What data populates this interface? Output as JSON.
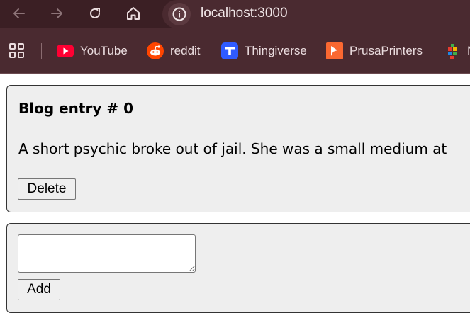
{
  "browser": {
    "url": "localhost:3000",
    "nav": {
      "back_icon": "arrow-left-icon",
      "forward_icon": "arrow-right-icon",
      "reload_icon": "reload-icon",
      "home_icon": "home-icon",
      "site_info_icon": "info-icon"
    },
    "bookmarks": [
      {
        "label": "YouTube",
        "icon": "youtube-icon",
        "color": "#ff0033"
      },
      {
        "label": "reddit",
        "icon": "reddit-icon",
        "color": "#ff4500"
      },
      {
        "label": "Thingiverse",
        "icon": "thingiverse-icon",
        "color": "#2f5bff"
      },
      {
        "label": "PrusaPrinters",
        "icon": "prusa-icon",
        "color": "#fa6831"
      },
      {
        "label": "N",
        "icon": "multicolor-icon",
        "color": "#e0a000"
      }
    ],
    "colors": {
      "toolbar": "#3b1f24",
      "bookmark_bar": "#4a2a30",
      "text": "#eadcde"
    }
  },
  "blog": {
    "entries": [
      {
        "title": "Blog entry # 0",
        "body": "A short psychic broke out of jail. She was a small medium at",
        "delete_label": "Delete"
      }
    ],
    "new_entry": {
      "value": "",
      "add_label": "Add"
    }
  }
}
